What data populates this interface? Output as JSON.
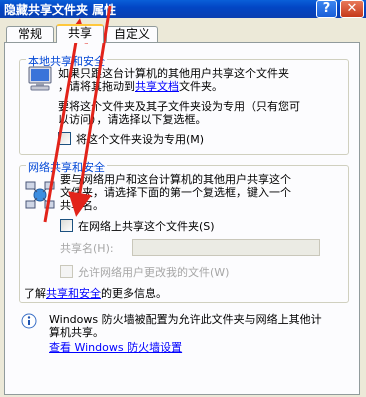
{
  "window": {
    "title": "隐藏共享文件夹 属性"
  },
  "title_buttons": {
    "help": "?",
    "close": "✕"
  },
  "tabs": [
    {
      "label": "常规"
    },
    {
      "label": "共享"
    },
    {
      "label": "自定义"
    }
  ],
  "local_section": {
    "legend": "本地共享和安全",
    "text1_line1": "如果只跟这台计算机的其他用户共享这个文件夹",
    "text1_line2_prefix": "，请将其拖动到",
    "text1_link": "共享文档",
    "text1_line2_suffix": "文件夹。",
    "text2_line1": "要将这个文件夹及其子文件夹设为专用（只有您可",
    "text2_line2": "以访问），请选择以下复选框。",
    "private_checkbox_label": "将这个文件夹设为专用(M)"
  },
  "network_section": {
    "legend": "网络共享和安全",
    "text_line1": "要与网络用户和这台计算机的其他用户共享这个",
    "text_line2": "文件夹，请选择下面的第一个复选框，键入一个",
    "text_line3": "共享名。",
    "share_checkbox_label": "在网络上共享这个文件夹(S)",
    "share_name_label": "共享名(H):",
    "share_name_value": "",
    "allow_change_label": "允许网络用户更改我的文件(W)",
    "more_info_prefix": "了解",
    "more_info_link": "共享和安全",
    "more_info_suffix": "的更多信息。"
  },
  "firewall": {
    "text_line1": "Windows 防火墙被配置为允许此文件夹与网络上其他计",
    "text_line2": "算机共享。",
    "settings_link": "查看 Windows 防火墙设置"
  },
  "colors": {
    "accent_arrow": "#e2231a",
    "link": "#0000ff",
    "legend": "#0046d5"
  }
}
